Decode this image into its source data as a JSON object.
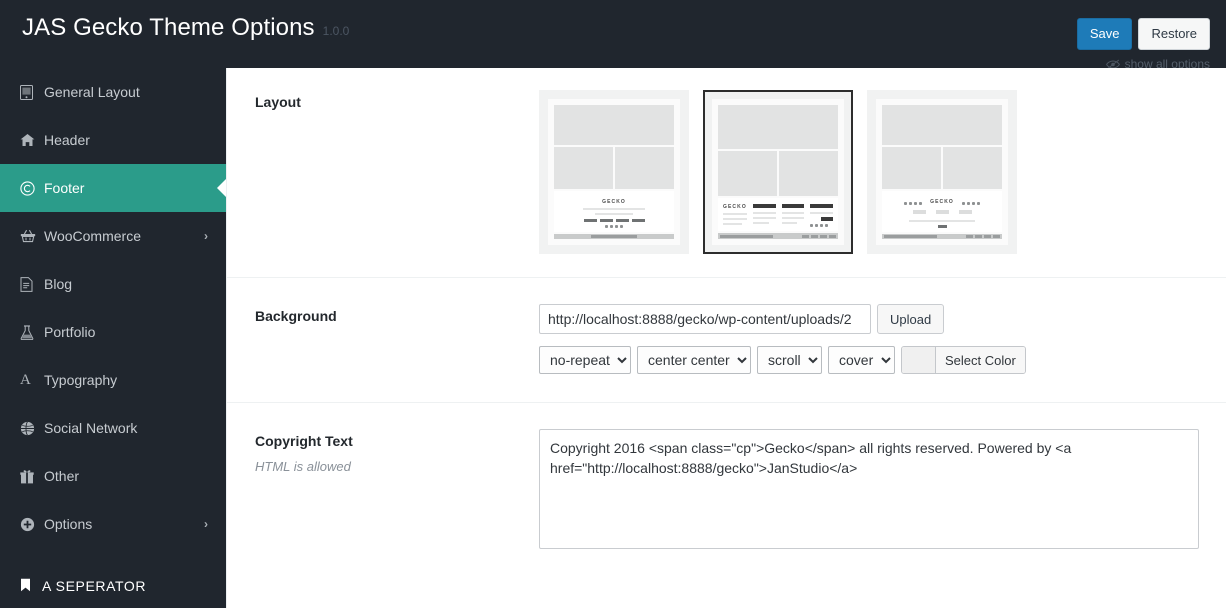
{
  "header": {
    "title": "JAS Gecko Theme Options",
    "version": "1.0.0",
    "save_label": "Save",
    "restore_label": "Restore",
    "show_all_label": "show all options",
    "icons": {
      "show_all": "eye-slash-icon"
    },
    "accent_color": "#1e7bb8",
    "background_color": "#20262e"
  },
  "sidebar": {
    "active_color": "#2b9c8a",
    "items": [
      {
        "label": "General Layout",
        "icon": "tablet-icon",
        "glyph": "▢",
        "active": false,
        "has_submenu": false
      },
      {
        "label": "Header",
        "icon": "home-icon",
        "glyph": "⌂",
        "active": false,
        "has_submenu": false
      },
      {
        "label": "Footer",
        "icon": "copyright-icon",
        "glyph": "©",
        "active": true,
        "has_submenu": false
      },
      {
        "label": "WooCommerce",
        "icon": "basket-icon",
        "glyph": "⛃",
        "active": false,
        "has_submenu": true
      },
      {
        "label": "Blog",
        "icon": "file-text-icon",
        "glyph": "▤",
        "active": false,
        "has_submenu": false
      },
      {
        "label": "Portfolio",
        "icon": "flask-icon",
        "glyph": "⚲",
        "active": false,
        "has_submenu": false
      },
      {
        "label": "Typography",
        "icon": "font-icon",
        "glyph": "A",
        "active": false,
        "has_submenu": false
      },
      {
        "label": "Social Network",
        "icon": "globe-icon",
        "glyph": "◕",
        "active": false,
        "has_submenu": false
      },
      {
        "label": "Other",
        "icon": "gift-icon",
        "glyph": "☕",
        "active": false,
        "has_submenu": false
      },
      {
        "label": "Options",
        "icon": "plus-circle-icon",
        "glyph": "⊕",
        "active": false,
        "has_submenu": true
      }
    ],
    "separator": {
      "label": "A SEPERATOR",
      "icon": "bookmark-icon",
      "glyph": "⚑"
    },
    "submenu_arrow": "›"
  },
  "fields": {
    "layout": {
      "title": "Layout",
      "selected_index": 1,
      "options": [
        {
          "name": "footer-centered-stacked",
          "logo_text": "GECKO",
          "selected": false
        },
        {
          "name": "footer-left-logo-four-columns",
          "logo_text": "GECKO",
          "selected": true
        },
        {
          "name": "footer-centered-with-social",
          "logo_text": "GECKO",
          "selected": false
        }
      ]
    },
    "background": {
      "title": "Background",
      "url_value": "http://localhost:8888/gecko/wp-content/uploads/2",
      "url_placeholder": "",
      "upload_label": "Upload",
      "repeat_value": "no-repeat",
      "position_value": "center center",
      "attachment_value": "scroll",
      "size_value": "cover",
      "select_color_label": "Select Color",
      "color_swatch": "#f0f0f0"
    },
    "copyright": {
      "title": "Copyright Text",
      "subtitle": "HTML is allowed",
      "value": "Copyright 2016 <span class=\"cp\">Gecko</span> all rights reserved. Powered by <a href=\"http://localhost:8888/gecko\">JanStudio</a>"
    }
  }
}
